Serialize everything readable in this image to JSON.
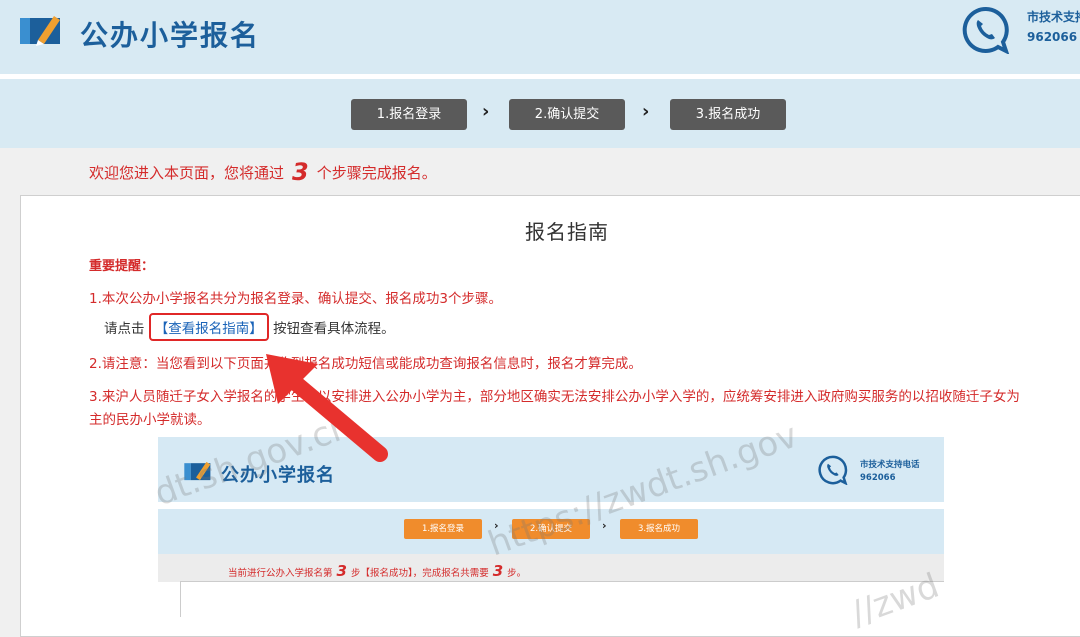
{
  "header": {
    "title": "公办小学报名",
    "support_label": "市技术支持",
    "support_number": "962066"
  },
  "steps": [
    "1.报名登录",
    "2.确认提交",
    "3.报名成功"
  ],
  "welcome": {
    "prefix": "欢迎您进入本页面，您将通过",
    "count": "3",
    "suffix": "个步骤完成报名。"
  },
  "guide": {
    "title": "报名指南",
    "important": "重要提醒：",
    "item1": "1.本次公办小学报名共分为报名登录、确认提交、报名成功3个步骤。",
    "item1b_prefix": "请点击",
    "item1b_link": "【查看报名指南】",
    "item1b_suffix": "按钮查看具体流程。",
    "item2": "2.请注意：当您看到以下页面并收到报名成功短信或能成功查询报名信息时，报名才算完成。",
    "item3": "3.来沪人员随迁子女入学报名的学生，以安排进入公办小学为主，部分地区确实无法安排公办小学入学的，应统筹安排进入政府购买服务的以招收随迁子女为",
    "item3b": "主的民办小学就读。"
  },
  "preview": {
    "title": "公办小学报名",
    "support_label": "市技术支持电话",
    "support_number": "962066",
    "steps": [
      "1.报名登录",
      "2.确认提交",
      "3.报名成功"
    ],
    "progress_prefix": "当前进行公办入学报名第",
    "progress_step": "3",
    "progress_mid": "步【报名成功】，完成报名共需要",
    "progress_total": "3",
    "progress_suffix": "步。"
  },
  "watermarks": [
    "dt.sh.gov.cn",
    "https://zwdt.sh.gov",
    "//zwd"
  ],
  "colors": {
    "brand_blue": "#1c5f9b",
    "header_bg": "#d8eaf3",
    "alert_red": "#d42b2b",
    "step_gray": "#5a5a5a",
    "preview_step_orange": "#f08c2c"
  }
}
